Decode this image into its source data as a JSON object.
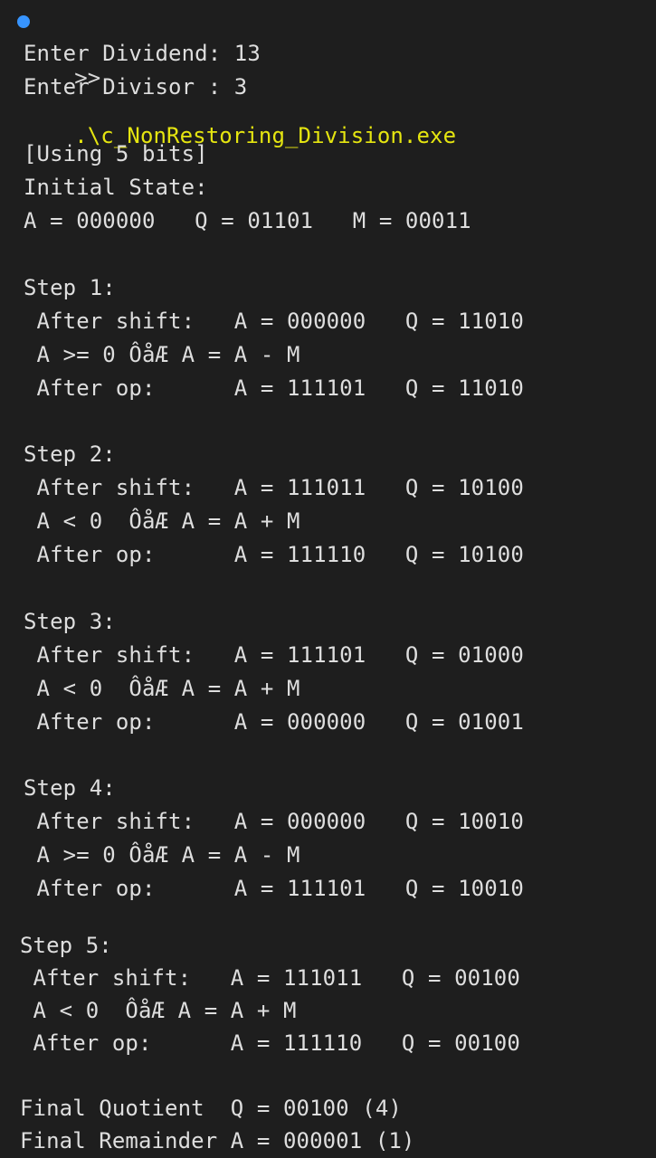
{
  "window": {
    "accent_color": "#3794ff",
    "command_color": "#e5e510",
    "background": "#1e1e1e",
    "text_color": "#dedede"
  },
  "prompt": {
    "marker": ">>",
    "command": ".\\c_NonRestoring_Division.exe"
  },
  "output": {
    "dividend": "Enter Dividend: 13",
    "divisor": "Enter Divisor : 3",
    "bits": "[Using 5 bits]",
    "initial_title": "Initial State:",
    "initial_values": "A = 000000   Q = 01101   M = 00011",
    "steps": [
      {
        "title": "Step 1:",
        "shift": " After shift:   A = 000000   Q = 11010",
        "condition": " A >= 0 ÔåÆ A = A - M",
        "op": " After op:      A = 111101   Q = 11010"
      },
      {
        "title": "Step 2:",
        "shift": " After shift:   A = 111011   Q = 10100",
        "condition": " A < 0  ÔåÆ A = A + M",
        "op": " After op:      A = 111110   Q = 10100"
      },
      {
        "title": "Step 3:",
        "shift": " After shift:   A = 111101   Q = 01000",
        "condition": " A < 0  ÔåÆ A = A + M",
        "op": " After op:      A = 000000   Q = 01001"
      },
      {
        "title": "Step 4:",
        "shift": " After shift:   A = 000000   Q = 10010",
        "condition": " A >= 0 ÔåÆ A = A - M",
        "op": " After op:      A = 111101   Q = 10010"
      },
      {
        "title": "Step 5:",
        "shift": " After shift:   A = 111011   Q = 00100",
        "condition": " A < 0  ÔåÆ A = A + M",
        "op": " After op:      A = 111110   Q = 00100"
      }
    ],
    "final_quotient": "Final Quotient  Q = 00100 (4)",
    "final_remainder": "Final Remainder A = 000001 (1)"
  }
}
